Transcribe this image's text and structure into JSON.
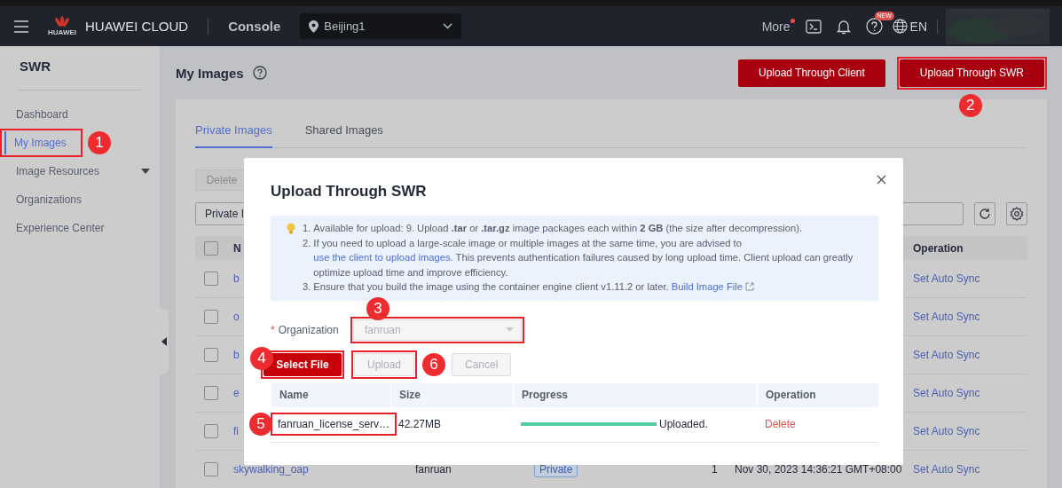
{
  "topbar": {
    "logo_text": "HUAWEI",
    "brand": "HUAWEI CLOUD",
    "console": "Console",
    "region": "Beijing1",
    "more": "More",
    "help_badge": "NEW",
    "language": "EN"
  },
  "sidebar": {
    "title": "SWR",
    "items": [
      {
        "label": "Dashboard",
        "selected": false,
        "expandable": false,
        "marked": false
      },
      {
        "label": "My Images",
        "selected": true,
        "expandable": false,
        "marked": true,
        "callout": "1"
      },
      {
        "label": "Image Resources",
        "selected": false,
        "expandable": true,
        "marked": false
      },
      {
        "label": "Organizations",
        "selected": false,
        "expandable": false,
        "marked": false
      },
      {
        "label": "Experience Center",
        "selected": false,
        "expandable": false,
        "marked": false
      }
    ]
  },
  "page": {
    "title": "My Images",
    "buttons": [
      {
        "label": "Upload Through Client",
        "marked": false
      },
      {
        "label": "Upload Through SWR",
        "marked": true,
        "callout": "2"
      }
    ]
  },
  "tabs": [
    {
      "label": "Private Images",
      "selected": true
    },
    {
      "label": "Shared Images",
      "selected": false
    }
  ],
  "toolbar": {
    "delete_button": "Delete",
    "filter": "Private I"
  },
  "table": {
    "all_checked": false,
    "columns": [
      "N",
      "Operation"
    ],
    "rows": [
      {
        "checked": false,
        "name": "b",
        "operation": "Set Auto Sync"
      },
      {
        "checked": false,
        "name": "o",
        "operation": "Set Auto Sync"
      },
      {
        "checked": false,
        "name": "b",
        "operation": "Set Auto Sync"
      },
      {
        "checked": false,
        "name": "e",
        "operation": "Set Auto Sync"
      },
      {
        "checked": false,
        "name": "fi",
        "operation": "Set Auto Sync"
      },
      {
        "checked": false,
        "name": "skywalking_oap",
        "organization": "fanruan",
        "type": "Private",
        "count": "1",
        "updated": "Nov 30, 2023 14:36:21 GMT+08:00",
        "operation": "Set Auto Sync"
      }
    ]
  },
  "dialog": {
    "title": "Upload Through SWR",
    "notes": [
      {
        "number": "1.",
        "text": "Available for upload: 9. Upload **.tar** or **.tar.gz** image packages each within **2 GB** (the size after decompression)."
      },
      {
        "number": "2.",
        "text": "If you need to upload a large-scale image or multiple images at the same time, you are advised to",
        "link": "use the client to upload images",
        "text_after": ". This prevents authentication failures caused by long upload time. Client upload can greatly optimize upload time and improve efficiency."
      },
      {
        "number": "3.",
        "text": "Ensure that you build the image using the container engine client v1.11.2 or later.",
        "link": "Build Image File",
        "external": true
      }
    ],
    "organization": {
      "label": "Organization",
      "required_mark": "*",
      "value": "fanruan",
      "disabled": true,
      "marked": true,
      "callout": "3"
    },
    "buttons": [
      {
        "label": "Select File",
        "kind": "primary",
        "disabled": false,
        "marked": true,
        "callout": "4"
      },
      {
        "label": "Upload",
        "kind": "secondary",
        "disabled": true,
        "marked": true,
        "callout": "6"
      },
      {
        "label": "Cancel",
        "kind": "secondary",
        "disabled": true,
        "marked": false
      }
    ],
    "files": {
      "columns": [
        "Name",
        "Size",
        "Progress",
        "Operation"
      ],
      "rows": [
        {
          "name": "fanruan_license_serv…",
          "size": "42.27MB",
          "level": 1,
          "status": "Uploaded.",
          "action": "Delete",
          "marked": true,
          "callout": "5"
        }
      ]
    }
  }
}
